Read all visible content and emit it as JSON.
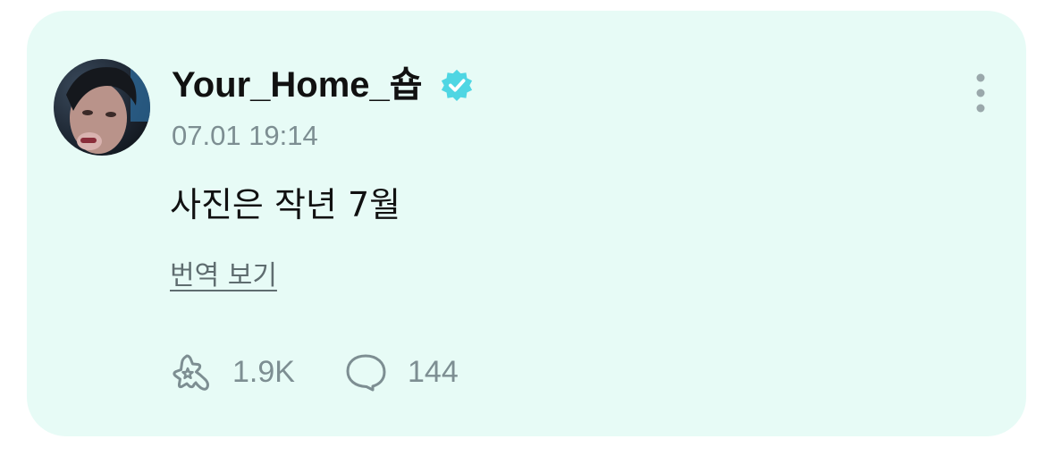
{
  "post": {
    "username": "Your_Home_숍",
    "timestamp": "07.01 19:14",
    "text": "사진은 작년 7월",
    "translate_label": "번역 보기",
    "likes_count": "1.9K",
    "comments_count": "144"
  },
  "colors": {
    "card_background": "#e7fbf6",
    "verified_badge": "#4fd6e3",
    "muted_text": "#7d8e92"
  },
  "icons": {
    "verified": "verified-badge-icon",
    "more": "more-vertical-icon",
    "like": "star-bubble-icon",
    "comment": "comment-bubble-icon"
  }
}
